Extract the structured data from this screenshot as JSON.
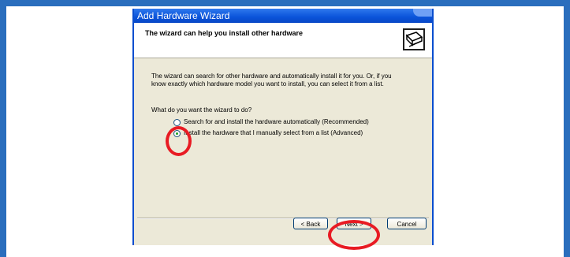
{
  "window": {
    "title": "Add Hardware Wizard"
  },
  "header": {
    "title": "The wizard can help you install other hardware",
    "icon": "hardware-wizard-icon"
  },
  "body": {
    "intro": "The wizard can search for other hardware and automatically install it for you. Or, if you know exactly which hardware model you want to install, you can select it from a list.",
    "question": "What do you want the wizard to do?",
    "options": [
      {
        "label": "Search for and install the hardware automatically (Recommended)",
        "selected": false
      },
      {
        "label": "Install the hardware that I manually select from a list (Advanced)",
        "selected": true
      }
    ]
  },
  "buttons": {
    "back": "< Back",
    "next": "Next >",
    "cancel": "Cancel"
  },
  "colors": {
    "background": "#2a6ebd",
    "annotation": "#e81b23",
    "titlebar": "#0a53d9"
  }
}
